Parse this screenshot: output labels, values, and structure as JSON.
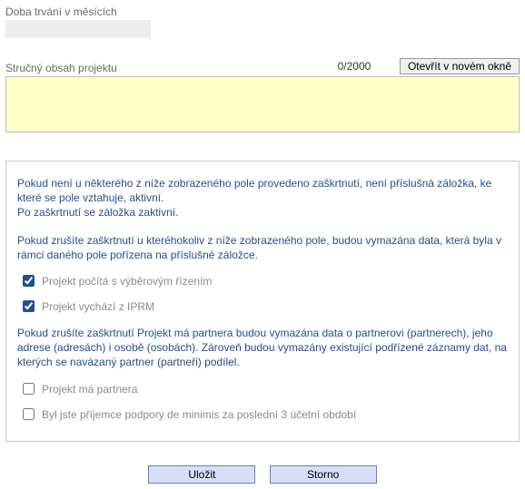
{
  "duration": {
    "label": "Doba trvání v měsících",
    "value": ""
  },
  "summary": {
    "label": "Stručný obsah projektu",
    "counter": "0/2000",
    "open_button": "Otevřít v novém okně",
    "value": ""
  },
  "info": {
    "p1": "Pokud není u některého z níže zobrazeného pole provedeno zaškrtnutí, není příslušná záložka, ke které se pole vztahuje, aktivní.",
    "p1b": "Po zaškrtnutí se záložka zaktivní.",
    "p2": "Pokud zrušíte zaškrtnutí u kteréhokoliv z níže zobrazeného pole, budou vymazána data, která byla v rámci daného pole pořízena na příslušné záložce.",
    "cb1": {
      "label": "Projekt počítá s výběrovým řízením",
      "checked": true
    },
    "cb2": {
      "label": "Projekt vychází z IPRM",
      "checked": true
    },
    "p3": "Pokud zrušíte zaškrtnutí Projekt má partnera budou vymazána data o partnerovi (partnerech), jeho adrese (adresách) i osobě (osobách). Zároveň budou vymazány existující podřízené záznamy dat, na kterých se navázaný partner (partneři) podílel.",
    "cb3": {
      "label": "Projekt má partnera",
      "checked": false
    },
    "cb4": {
      "label": "Byl jste příjemce podpory de minimis za poslední 3 účetní období",
      "checked": false
    }
  },
  "buttons": {
    "save": "Uložit",
    "cancel": "Storno"
  }
}
